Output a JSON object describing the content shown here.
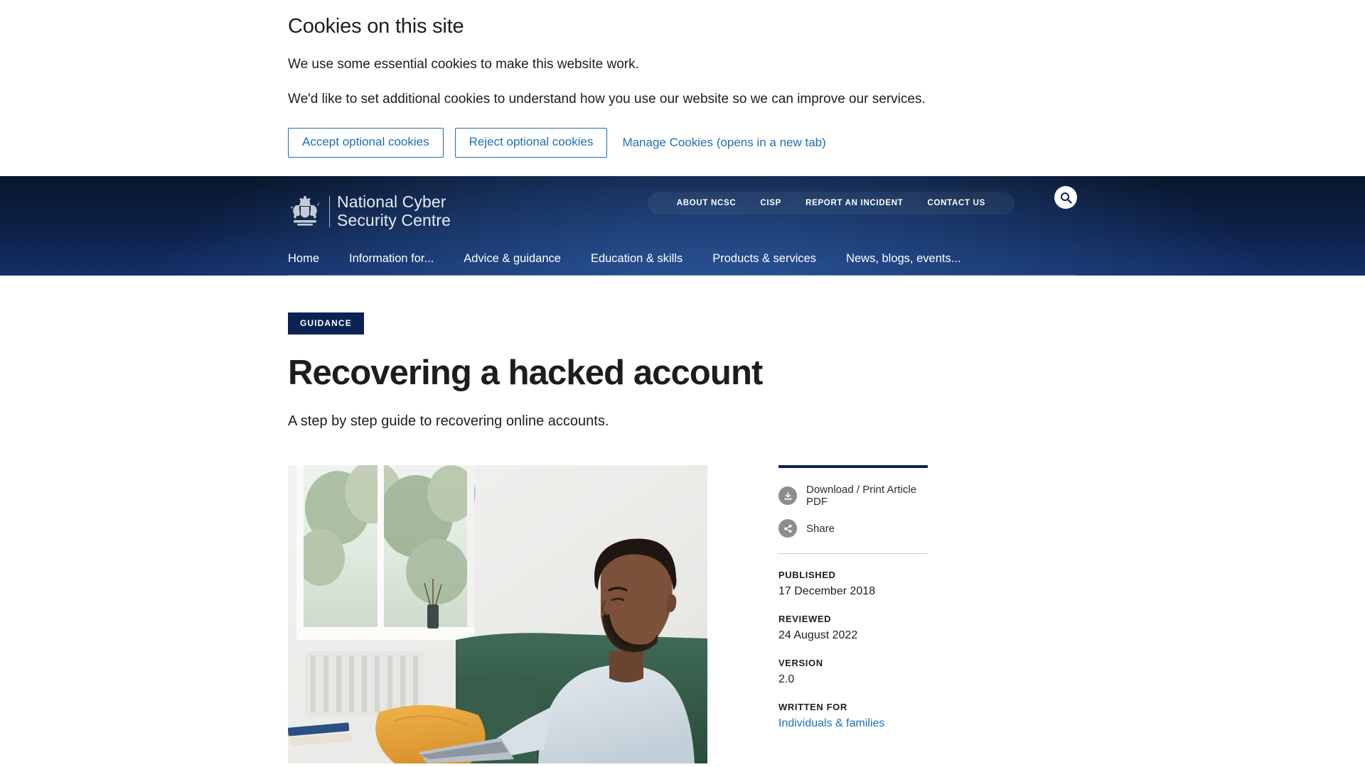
{
  "cookie_banner": {
    "title": "Cookies on this site",
    "paragraph_1": "We use some essential cookies to make this website work.",
    "paragraph_2": "We'd like to set additional cookies to understand how you use our website so we can improve our services.",
    "accept_label": "Accept optional cookies",
    "reject_label": "Reject optional cookies",
    "manage_label": "Manage Cookies (opens in a new tab)",
    "link_color": "#1f6fb2"
  },
  "header": {
    "brand_line_1": "National Cyber",
    "brand_line_2": "Security Centre",
    "crest_icon": "royal-coat-of-arms-icon",
    "search_icon": "search-icon",
    "utility_nav": [
      {
        "label": "ABOUT NCSC"
      },
      {
        "label": "CISP"
      },
      {
        "label": "REPORT AN INCIDENT"
      },
      {
        "label": "CONTACT US"
      }
    ],
    "main_nav": [
      {
        "label": "Home"
      },
      {
        "label": "Information for..."
      },
      {
        "label": "Advice & guidance"
      },
      {
        "label": "Education & skills"
      },
      {
        "label": "Products & services"
      },
      {
        "label": "News, blogs, events..."
      }
    ],
    "background_color": "#0d2148"
  },
  "article": {
    "badge": "GUIDANCE",
    "badge_color": "#0b2253",
    "title": "Recovering a hacked account",
    "standfirst": "A step by step guide to recovering online accounts.",
    "hero_alt": "Man sitting on a green sofa with an orange cushion, looking at a laptop by a bright window"
  },
  "sidebar": {
    "download_icon": "download-icon",
    "download_label": "Download / Print Article PDF",
    "share_icon": "share-icon",
    "share_label": "Share",
    "meta": [
      {
        "key": "PUBLISHED",
        "value": "17 December 2018",
        "is_link": false
      },
      {
        "key": "REVIEWED",
        "value": "24 August 2022",
        "is_link": false
      },
      {
        "key": "VERSION",
        "value": "2.0",
        "is_link": false
      },
      {
        "key": "WRITTEN FOR",
        "value": "Individuals & families",
        "is_link": true
      }
    ]
  }
}
